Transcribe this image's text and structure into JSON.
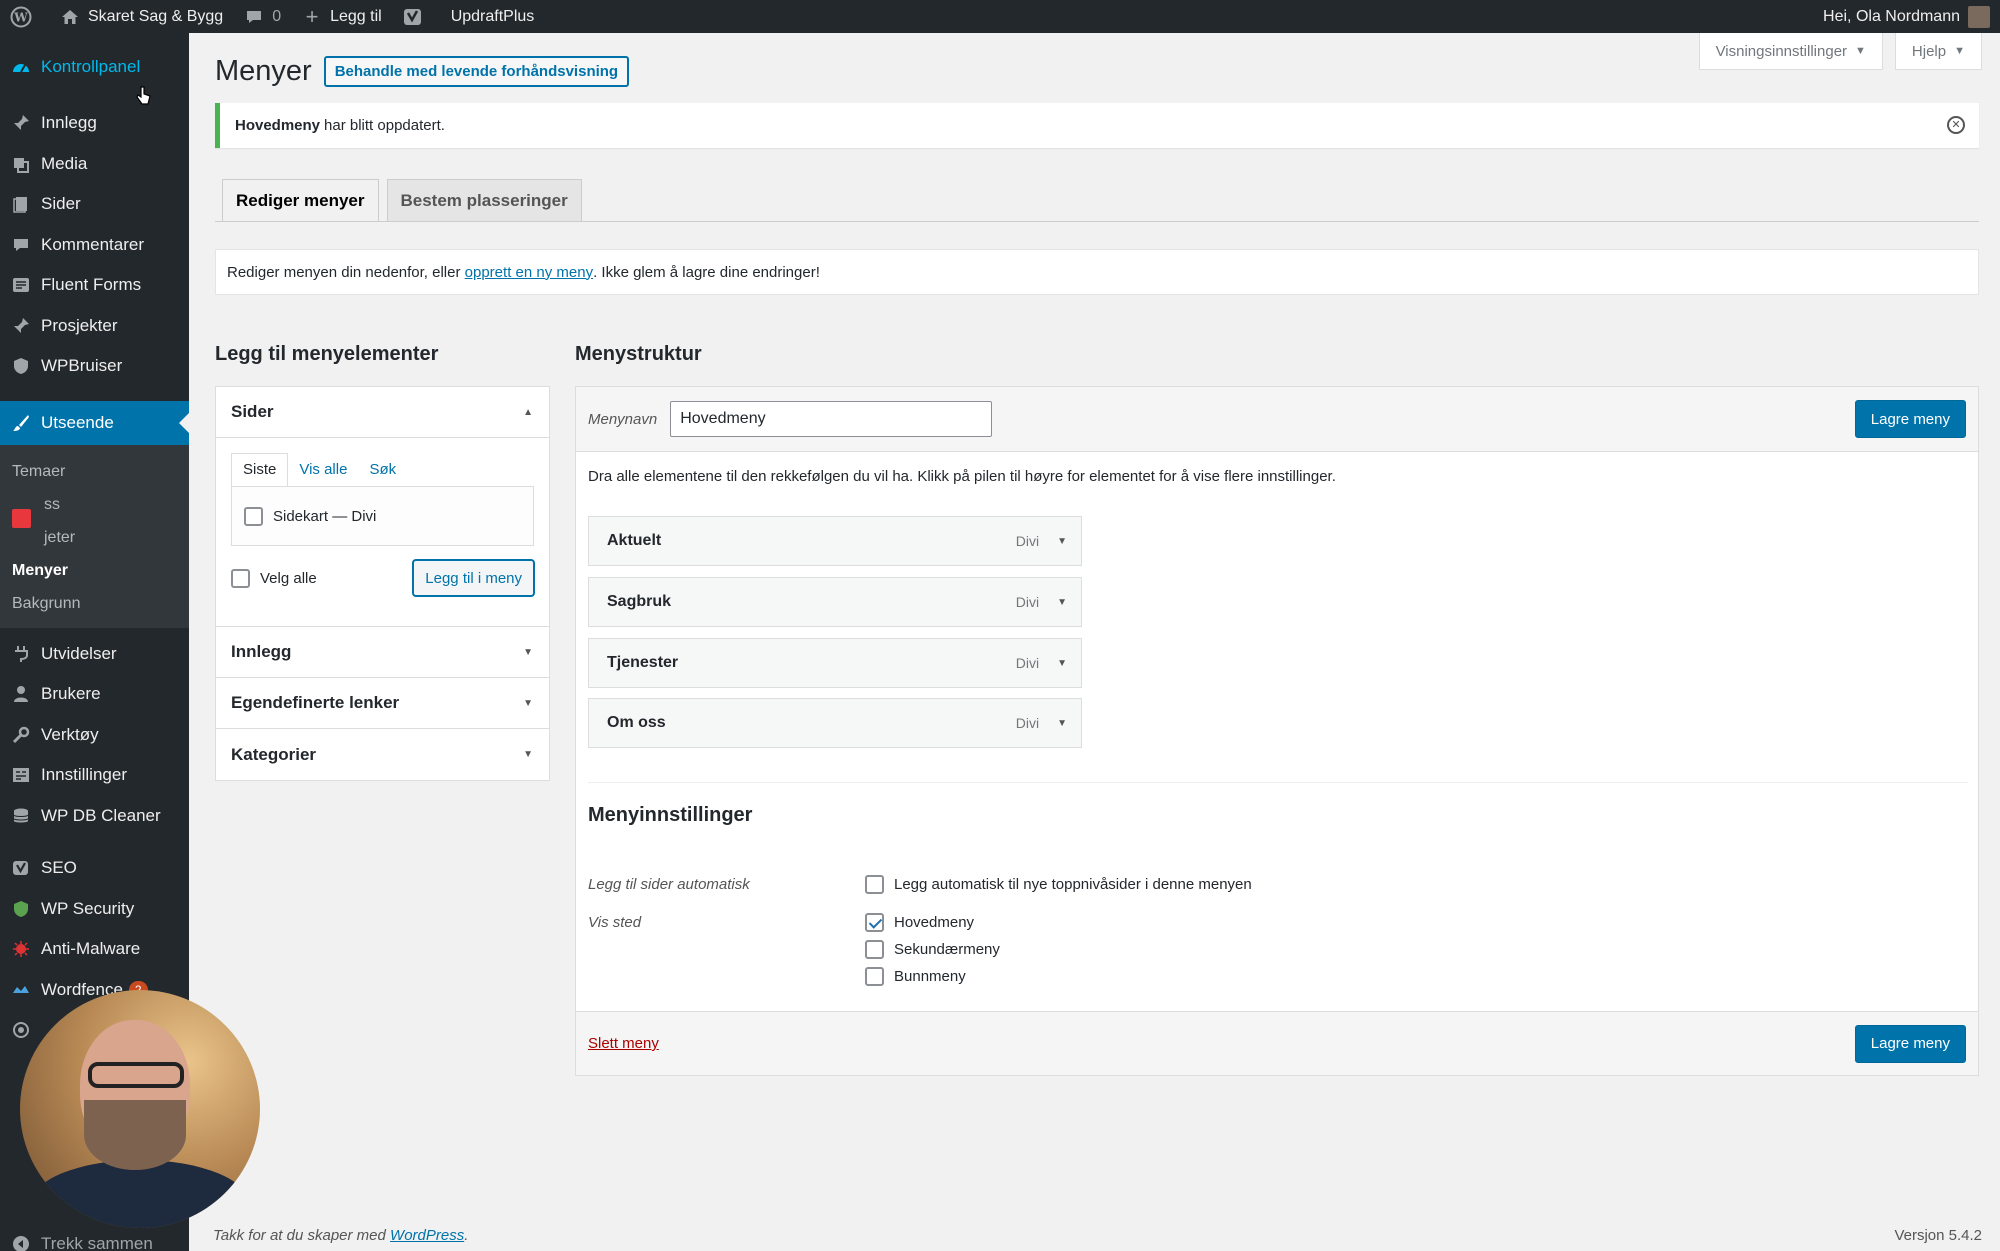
{
  "adminbar": {
    "site_name": "Skaret Sag & Bygg",
    "comments_count": "0",
    "add_new": "Legg til",
    "plugin": "UpdraftPlus",
    "greeting": "Hei, Ola Nordmann"
  },
  "sidebar": {
    "dashboard": "Kontrollpanel",
    "items_top": [
      "Innlegg",
      "Media",
      "Sider",
      "Kommentarer",
      "Fluent Forms",
      "Prosjekter",
      "WPBruiser"
    ],
    "active": "Utseende",
    "submenu": [
      "Temaer",
      "ss",
      "jeter",
      "Menyer",
      "Bakgrunn"
    ],
    "items_bottom": [
      "Utvidelser",
      "Brukere",
      "Verktøy",
      "Innstillinger",
      "WP DB Cleaner",
      "SEO",
      "WP Security",
      "Anti-Malware",
      "Wordfence"
    ],
    "wordfence_badge": "2",
    "collapse": "Trekk sammen"
  },
  "screen_options": {
    "view_settings": "Visningsinnstillinger",
    "help": "Hjelp"
  },
  "page": {
    "title": "Menyer",
    "live_preview": "Behandle med levende forhåndsvisning"
  },
  "notice": {
    "bold": "Hovedmeny",
    "text": "har blitt oppdatert."
  },
  "tabs": [
    "Rediger menyer",
    "Bestem plasseringer"
  ],
  "manage": {
    "before": "Rediger menyen din nedenfor, eller ",
    "link": "opprett en ny meny",
    "after": ". Ikke glem å lagre dine endringer!"
  },
  "add_items": {
    "title": "Legg til menyelementer",
    "pages_section": "Sider",
    "inner_tabs": [
      "Siste",
      "Vis alle",
      "Søk"
    ],
    "page_item": "Sidekart — Divi",
    "select_all": "Velg alle",
    "add_to_menu": "Legg til i meny",
    "sections": [
      "Innlegg",
      "Egendefinerte lenker",
      "Kategorier"
    ]
  },
  "structure": {
    "title": "Menystruktur",
    "menu_name_label": "Menynavn",
    "menu_name_value": "Hovedmeny",
    "save": "Lagre meny",
    "instructions": "Dra alle elementene til den rekkefølgen du vil ha. Klikk på pilen til høyre for elementet for å vise flere innstillinger.",
    "items": [
      {
        "label": "Aktuelt",
        "type": "Divi"
      },
      {
        "label": "Sagbruk",
        "type": "Divi"
      },
      {
        "label": "Tjenester",
        "type": "Divi"
      },
      {
        "label": "Om oss",
        "type": "Divi"
      }
    ],
    "settings_title": "Menyinnstillinger",
    "auto_add_label": "Legg til sider automatisk",
    "auto_add_option": "Legg automatisk til nye toppnivåsider i denne menyen",
    "location_label": "Vis sted",
    "locations": [
      {
        "label": "Hovedmeny",
        "checked": true
      },
      {
        "label": "Sekundærmeny",
        "checked": false
      },
      {
        "label": "Bunnmeny",
        "checked": false
      }
    ],
    "delete": "Slett meny"
  },
  "footer": {
    "thanks_before": "Takk for at du skaper med ",
    "thanks_link": "WordPress",
    "thanks_after": ".",
    "version": "Versjon 5.4.2"
  }
}
